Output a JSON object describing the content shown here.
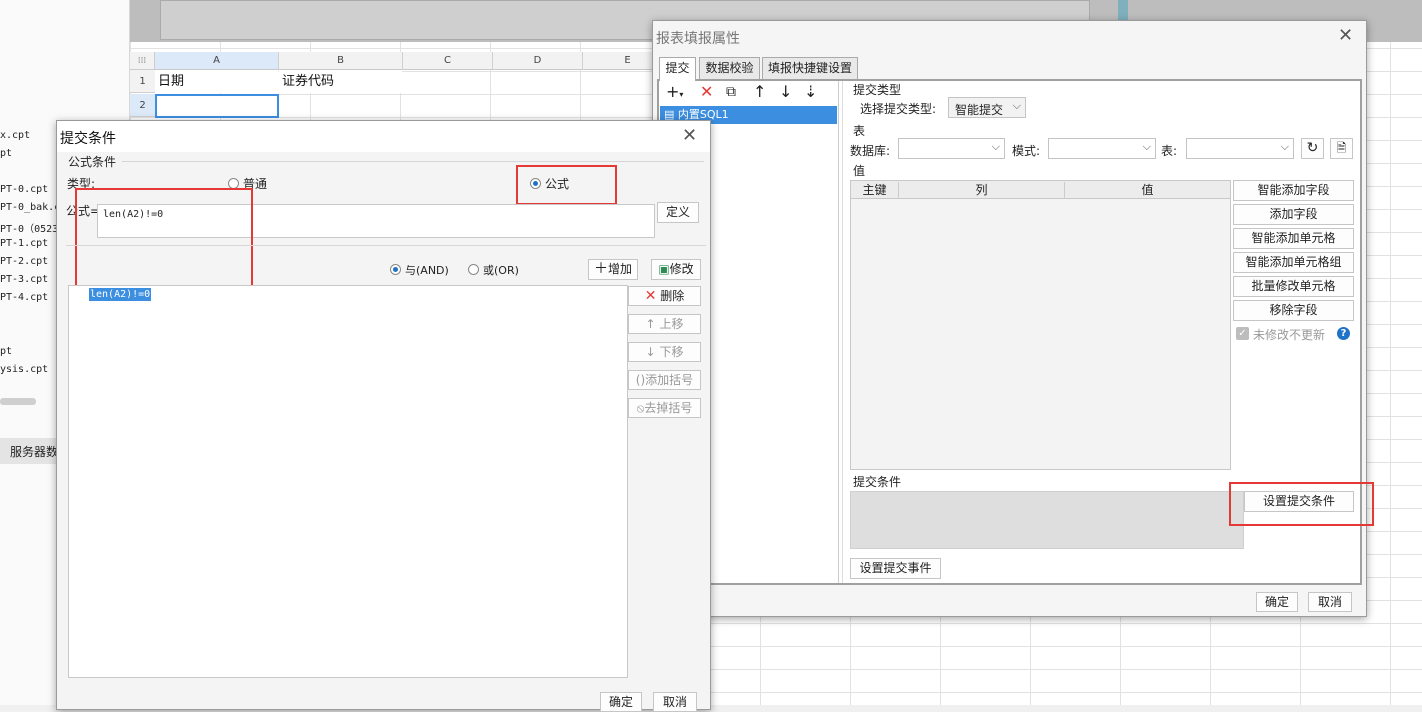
{
  "left_files": [
    "x.cpt",
    "pt",
    "PT-0.cpt",
    "PT-0_bak.c",
    "PT-0（0523",
    "PT-1.cpt",
    "PT-2.cpt",
    "PT-3.cpt",
    "PT-4.cpt",
    "pt",
    "ysis.cpt"
  ],
  "server_tab": "服务器数",
  "sheet": {
    "columns": [
      "A",
      "B",
      "C",
      "D",
      "E"
    ],
    "rows": [
      "1",
      "2"
    ],
    "cells": {
      "a1": "日期",
      "b1": "证券代码"
    }
  },
  "report_dialog": {
    "title": "报表填报属性",
    "tabs": [
      "提交",
      "数据校验",
      "填报快捷键设置"
    ],
    "toolbar_icons": [
      "add-icon",
      "delete-icon",
      "copy-icon",
      "move-up-icon",
      "move-down-icon",
      "move-bottom-icon"
    ],
    "tree_item": "内置SQL1",
    "submit_type_section": "提交类型",
    "submit_type_label": "选择提交类型:",
    "submit_type_value": "智能提交",
    "table_section": "表",
    "db_label": "数据库:",
    "mode_label": "模式:",
    "table_label": "表:",
    "value_section": "值",
    "table_headers": [
      "主键",
      "列",
      "值"
    ],
    "side_buttons": [
      "智能添加字段",
      "添加字段",
      "智能添加单元格",
      "智能添加单元格组",
      "批量修改单元格",
      "移除字段"
    ],
    "no_update_label": "未修改不更新",
    "submit_condition_section": "提交条件",
    "set_condition_button": "设置提交条件",
    "set_event_button": "设置提交事件",
    "ok": "确定",
    "cancel": "取消"
  },
  "condition_dialog": {
    "title": "提交条件",
    "section": "公式条件",
    "type_label": "类型:",
    "type_options": [
      "普通",
      "公式"
    ],
    "type_selected": "公式",
    "formula_label": "公式=",
    "formula_value": "len(A2)!=0",
    "define_button": "定义",
    "logic_options": [
      "与(AND)",
      "或(OR)"
    ],
    "logic_selected": "与(AND)",
    "add_button": "增加",
    "modify_button": "修改",
    "list_items": [
      "len(A2)!=0"
    ],
    "side_buttons": [
      "删除",
      "上移",
      "下移",
      "添加括号",
      "去掉括号"
    ],
    "ok": "确定",
    "cancel": "取消"
  },
  "colors": {
    "highlight": "#e53935",
    "selection": "#3b8ee0",
    "accent": "#1e73c9"
  }
}
